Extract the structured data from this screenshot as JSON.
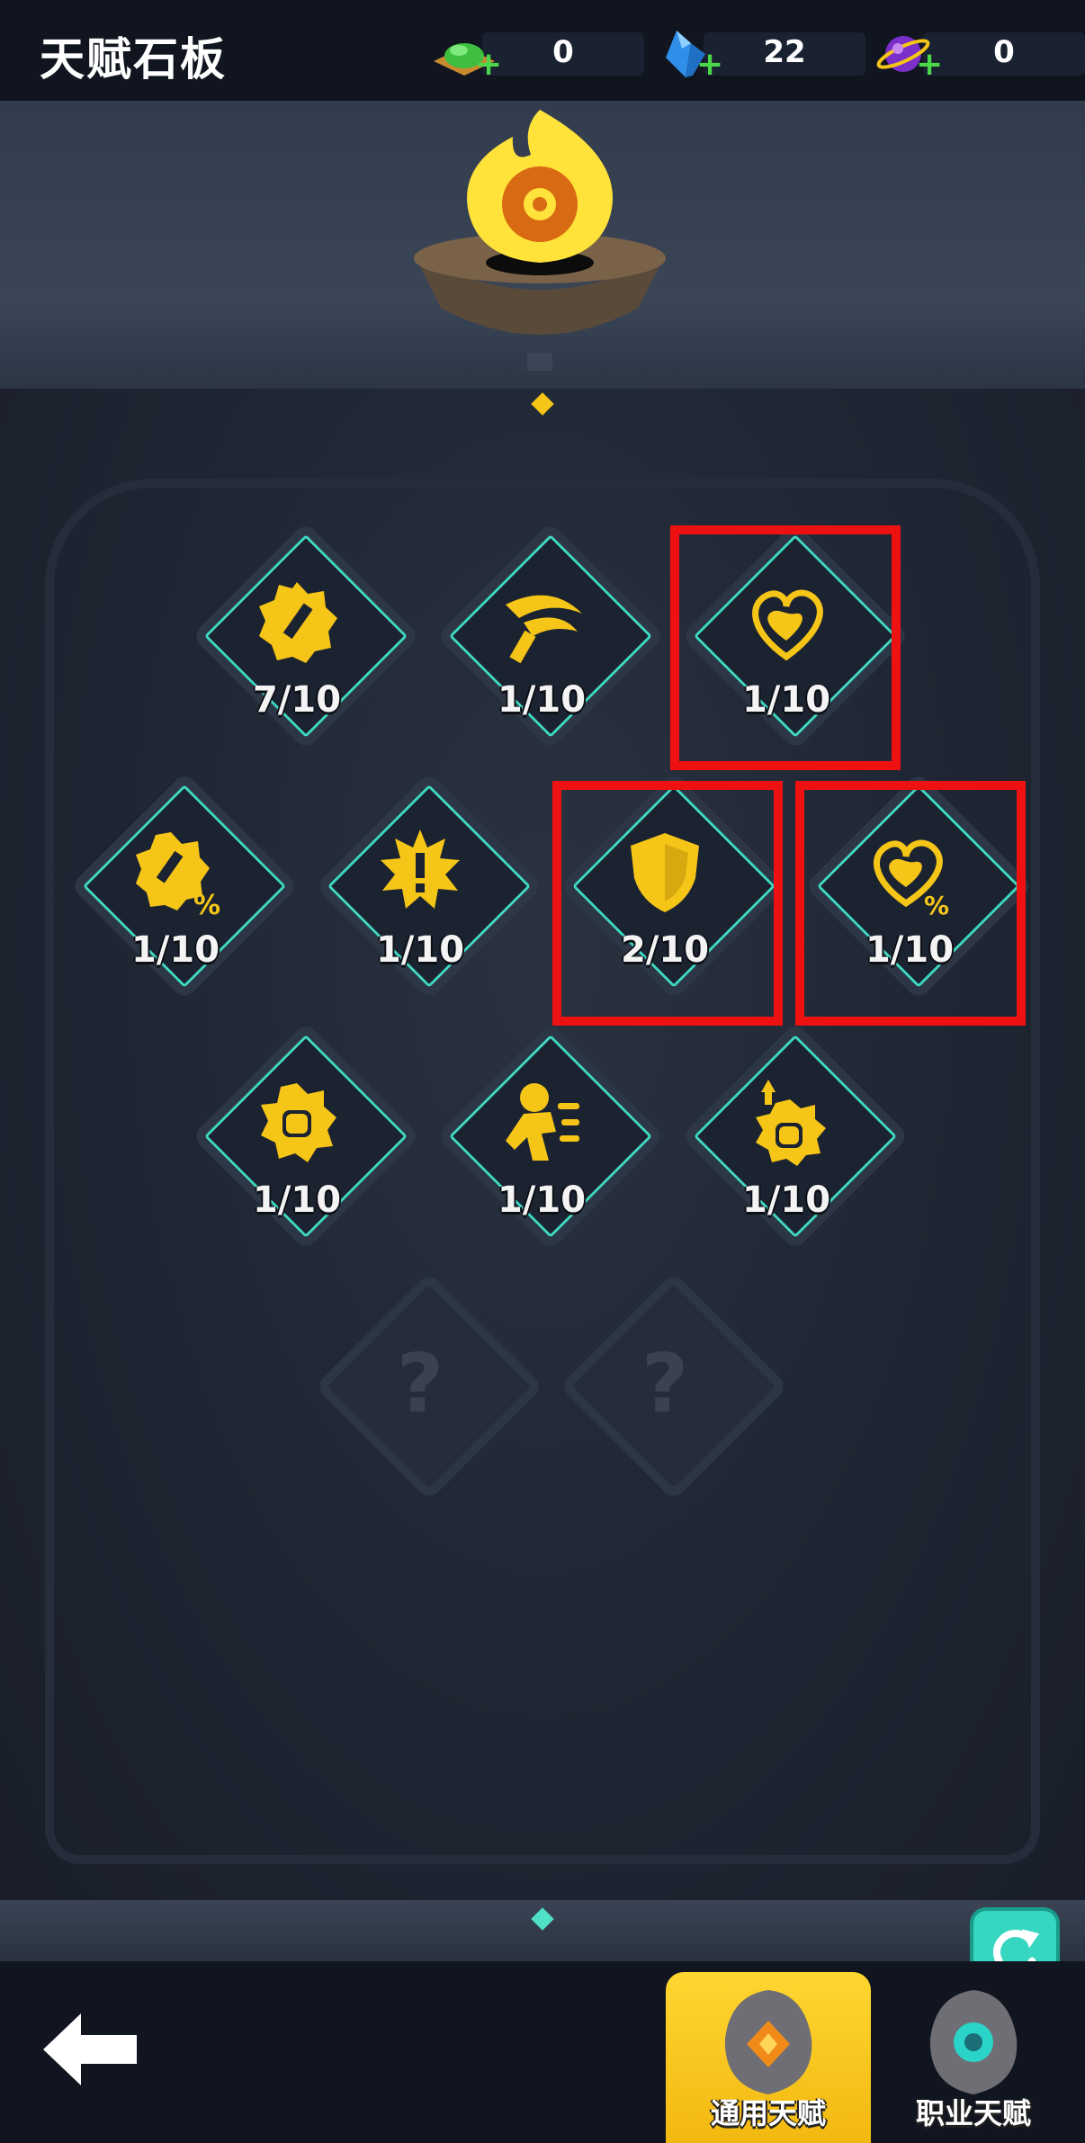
{
  "header": {
    "title": "天赋石板",
    "resources": [
      {
        "icon": "green-ore-icon",
        "value": "0"
      },
      {
        "icon": "blue-crystal-icon",
        "value": "22"
      },
      {
        "icon": "purple-orb-icon",
        "value": "0"
      }
    ]
  },
  "talents": [
    {
      "icon": "sword-badge-icon",
      "level": "7/10"
    },
    {
      "icon": "slash-blade-icon",
      "level": "1/10"
    },
    {
      "icon": "heart-icon",
      "level": "1/10"
    },
    {
      "icon": "sword-badge-percent-icon",
      "level": "1/10"
    },
    {
      "icon": "crit-burst-icon",
      "level": "1/10"
    },
    {
      "icon": "shield-icon",
      "level": "2/10"
    },
    {
      "icon": "heart-percent-icon",
      "level": "1/10"
    },
    {
      "icon": "fist-icon",
      "level": "1/10"
    },
    {
      "icon": "running-figure-icon",
      "level": "1/10"
    },
    {
      "icon": "fist-crit-icon",
      "level": "1/10"
    }
  ],
  "locked": [
    {
      "icon": "question-mark-icon",
      "label": "?"
    },
    {
      "icon": "question-mark-icon",
      "label": "?"
    }
  ],
  "tabs": [
    {
      "label": "通用天赋",
      "active": true
    },
    {
      "label": "职业天赋",
      "active": false
    }
  ],
  "colors": {
    "highlight": "#ee1111",
    "gold": "#f5c518",
    "teal": "#3fd9c2",
    "active_tab": "#ffd630"
  }
}
